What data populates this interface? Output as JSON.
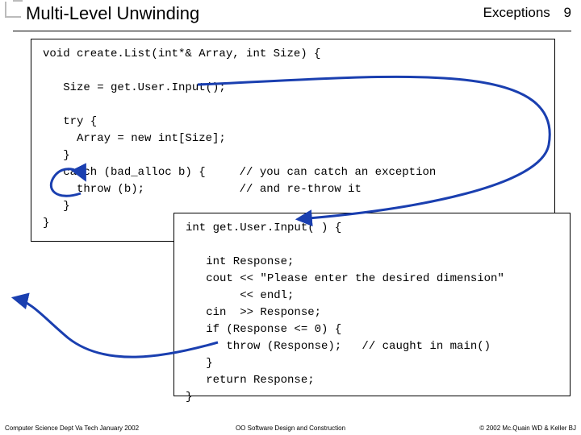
{
  "header": {
    "title": "Multi-Level Unwinding",
    "section": "Exceptions",
    "page": "9"
  },
  "code": {
    "box1_lines": [
      "void create.List(int*& Array, int Size) {",
      "",
      "   Size = get.User.Input();",
      "",
      "   try {",
      "     Array = new int[Size];",
      "   }",
      "   catch (bad_alloc b) {     // you can catch an exception",
      "     throw (b);              // and re-throw it",
      "   }",
      "}"
    ],
    "box2_lines": [
      "int get.User.Input( ) {",
      "",
      "   int Response;",
      "   cout << \"Please enter the desired dimension\"",
      "        << endl;",
      "   cin  >> Response;",
      "   if (Response <= 0) {",
      "      throw (Response);   // caught in main()",
      "   }",
      "   return Response;",
      "}"
    ]
  },
  "footer": {
    "left": "Computer Science Dept Va Tech January 2002",
    "center": "OO Software Design and Construction",
    "right": "© 2002  Mc.Quain WD & Keller BJ"
  },
  "arrows": {
    "color": "#1a3fb0",
    "stroke_width": 3
  }
}
